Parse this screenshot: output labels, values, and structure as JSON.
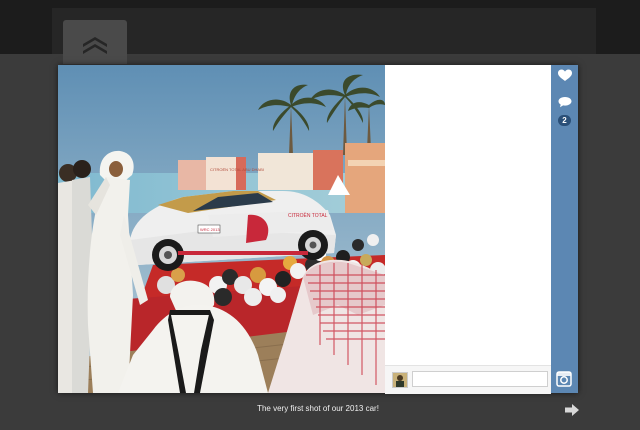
{
  "caption": "The very first shot of our 2013 car!",
  "actions": {
    "comment_count": "2"
  },
  "comment_box": {
    "placeholder": ""
  },
  "photo": {
    "car_livery_text": "CITROËN TOTAL",
    "banner_text": "CITROËN TOTAL ABU DHABI",
    "car_number": "WRC 2013"
  },
  "icons": {
    "brand": "citroen-chevron-icon",
    "like": "heart-icon",
    "comment": "speech-bubble-icon",
    "instagram": "instagram-icon",
    "next": "arrow-right-icon"
  },
  "colors": {
    "rail": "#5c87b3",
    "background": "#3b3b3b",
    "topbar": "#1c1c1c"
  }
}
